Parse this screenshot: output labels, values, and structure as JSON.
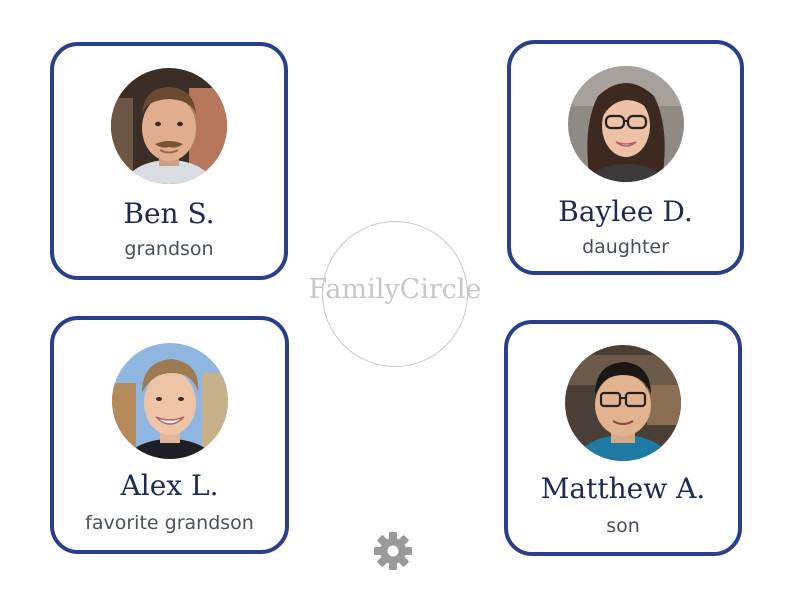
{
  "app": {
    "logo_text": "FamilyCircle"
  },
  "contacts": [
    {
      "name": "Ben S.",
      "relation": "grandson"
    },
    {
      "name": "Baylee D.",
      "relation": "daughter"
    },
    {
      "name": "Alex L.",
      "relation": "favorite grandson"
    },
    {
      "name": "Matthew A.",
      "relation": "son"
    }
  ],
  "settings": {
    "icon": "gear-icon"
  },
  "colors": {
    "card_border": "#2a3f8c",
    "name_text": "#1f2a52",
    "logo_text": "#c7c7c7",
    "gear": "#9a9a9a"
  }
}
